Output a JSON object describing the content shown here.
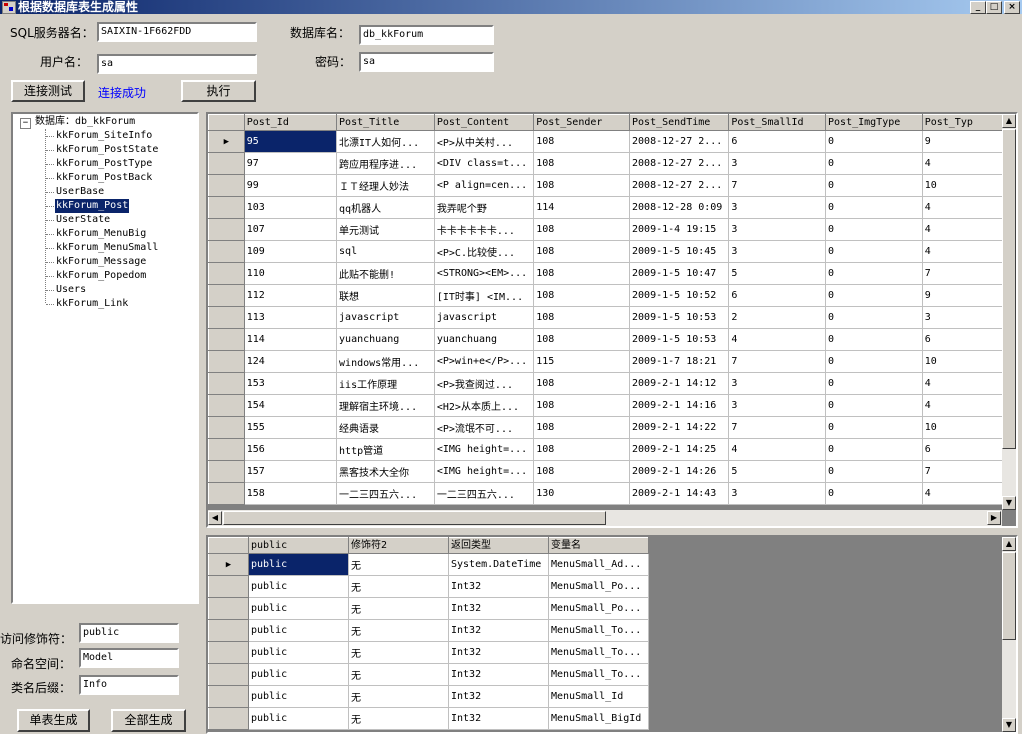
{
  "window": {
    "title": "根据数据库表生成属性",
    "minimize": "_",
    "maximize": "□",
    "close": "×"
  },
  "connection": {
    "server_label": "SQL服务器名：",
    "server_value": "SAIXIN-1F662FDD",
    "database_label": "数据库名：",
    "database_value": "db_kkForum",
    "user_label": "用户名：",
    "user_value": "sa",
    "password_label": "密码：",
    "password_value": "sa",
    "test_button": "连接测试",
    "status": "连接成功",
    "execute_button": "执行"
  },
  "tree": {
    "toggle": "−",
    "root": "数据库：db_kkForum",
    "tables": [
      "kkForum_SiteInfo",
      "kkForum_PostState",
      "kkForum_PostType",
      "kkForum_PostBack",
      "UserBase",
      "kkForum_Post",
      "UserState",
      "kkForum_MenuBig",
      "kkForum_MenuSmall",
      "kkForum_Message",
      "kkForum_Popedom",
      "Users",
      "kkForum_Link"
    ],
    "selected": "kkForum_Post"
  },
  "options": {
    "access_label": "访问修饰符：",
    "access_value": "public",
    "namespace_label": "命名空间：",
    "namespace_value": "Model",
    "suffix_label": "类名后缀：",
    "suffix_value": "Info",
    "single_button": "单表生成",
    "all_button": "全部生成"
  },
  "data_grid": {
    "columns": [
      "Post_Id",
      "Post_Title",
      "Post_Content",
      "Post_Sender",
      "Post_SendTime",
      "Post_SmallId",
      "Post_ImgType",
      "Post_Typ"
    ],
    "rows": [
      [
        "95",
        "北漂IT人如何...",
        "<P>从中关村...",
        "108",
        "2008-12-27 2...",
        "6",
        "0",
        "9"
      ],
      [
        "97",
        "跨应用程序进...",
        "<DIV class=t...",
        "108",
        "2008-12-27 2...",
        "3",
        "0",
        "4"
      ],
      [
        "99",
        "ＩＴ经理人妙法",
        "<P align=cen...",
        "108",
        "2008-12-27 2...",
        "7",
        "0",
        "10"
      ],
      [
        "103",
        "qq机器人",
        "我弄呢个野",
        "114",
        "2008-12-28 0:09",
        "3",
        "0",
        "4"
      ],
      [
        "107",
        "单元测试",
        "卡卡卡卡卡卡...",
        "108",
        "2009-1-4 19:15",
        "3",
        "0",
        "4"
      ],
      [
        "109",
        "sql",
        "<P>C.比较使...",
        "108",
        "2009-1-5 10:45",
        "3",
        "0",
        "4"
      ],
      [
        "110",
        "此贴不能删!",
        "<STRONG><EM>...",
        "108",
        "2009-1-5 10:47",
        "5",
        "0",
        "7"
      ],
      [
        "112",
        "联想",
        "[IT时事] <IM...",
        "108",
        "2009-1-5 10:52",
        "6",
        "0",
        "9"
      ],
      [
        "113",
        "javascript",
        "javascript",
        "108",
        "2009-1-5 10:53",
        "2",
        "0",
        "3"
      ],
      [
        "114",
        "yuanchuang",
        "yuanchuang",
        "108",
        "2009-1-5 10:53",
        "4",
        "0",
        "6"
      ],
      [
        "124",
        "windows常用...",
        "<P>win+e</P>...",
        "115",
        "2009-1-7 18:21",
        "7",
        "0",
        "10"
      ],
      [
        "153",
        "iis工作原理",
        "<P>我查阅过...",
        "108",
        "2009-2-1 14:12",
        "3",
        "0",
        "4"
      ],
      [
        "154",
        "理解宿主环境...",
        "<H2>从本质上...",
        "108",
        "2009-2-1 14:16",
        "3",
        "0",
        "4"
      ],
      [
        "155",
        "经典语录",
        "<P>流氓不可...",
        "108",
        "2009-2-1 14:22",
        "7",
        "0",
        "10"
      ],
      [
        "156",
        "http管道",
        "<IMG height=...",
        "108",
        "2009-2-1 14:25",
        "4",
        "0",
        "6"
      ],
      [
        "157",
        "黑客技术大全你",
        "<IMG height=...",
        "108",
        "2009-2-1 14:26",
        "5",
        "0",
        "7"
      ],
      [
        "158",
        "一二三四五六...",
        "一二三四五六...",
        "130",
        "2009-2-1 14:43",
        "3",
        "0",
        "4"
      ]
    ]
  },
  "props_grid": {
    "columns": [
      "public",
      "修饰符2",
      "返回类型",
      "变量名"
    ],
    "rows": [
      [
        "public",
        "无",
        "System.DateTime",
        "MenuSmall_Ad..."
      ],
      [
        "public",
        "无",
        "Int32",
        "MenuSmall_Po..."
      ],
      [
        "public",
        "无",
        "Int32",
        "MenuSmall_Po..."
      ],
      [
        "public",
        "无",
        "Int32",
        "MenuSmall_To..."
      ],
      [
        "public",
        "无",
        "Int32",
        "MenuSmall_To..."
      ],
      [
        "public",
        "无",
        "Int32",
        "MenuSmall_To..."
      ],
      [
        "public",
        "无",
        "Int32",
        "MenuSmall_Id"
      ],
      [
        "public",
        "无",
        "Int32",
        "MenuSmall_BigId"
      ]
    ]
  }
}
